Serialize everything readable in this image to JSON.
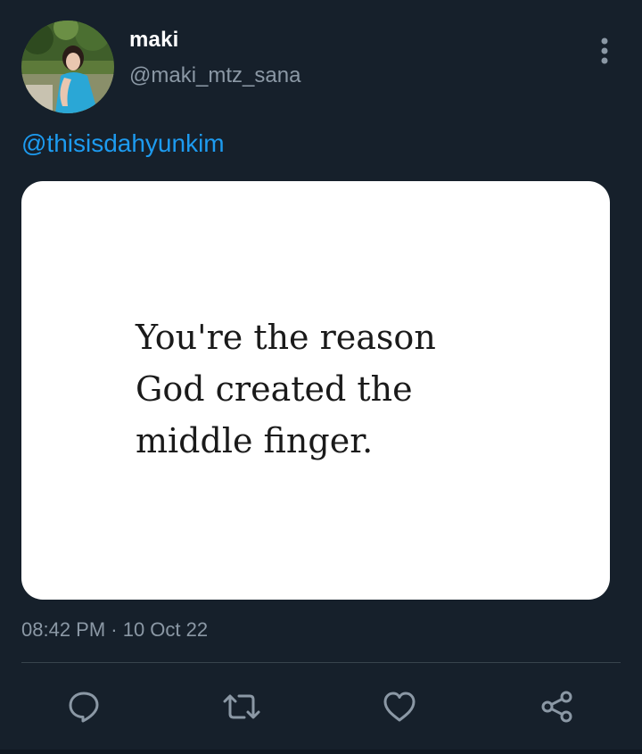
{
  "author": {
    "display_name": "maki",
    "handle": "@maki_mtz_sana"
  },
  "tweet": {
    "mention": "@thisisdahyunkim",
    "media_text_lines": [
      "You're the reason",
      "God created the",
      "middle finger."
    ],
    "timestamp": "08:42 PM · 10 Oct 22"
  },
  "icons": {
    "more": "more-vertical-icon",
    "reply": "reply-bubble-icon",
    "retweet": "retweet-icon",
    "like": "heart-icon",
    "share": "share-icon"
  },
  "colors": {
    "background": "#15202b",
    "link": "#1d9bf0",
    "secondary_text": "#8b98a5",
    "divider": "#38444d",
    "icon": "#8b98a5"
  }
}
